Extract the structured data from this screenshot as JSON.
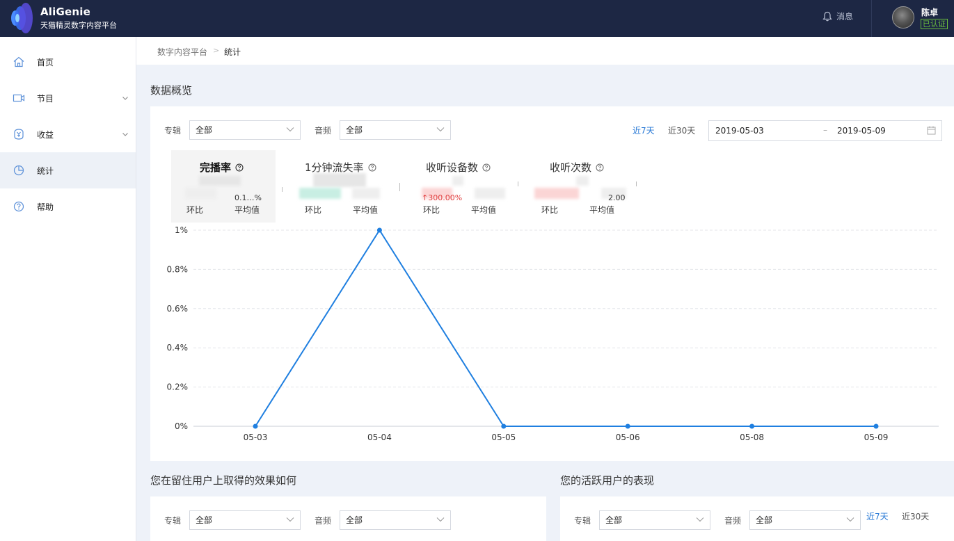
{
  "header": {
    "brand_name": "AliGenie",
    "brand_sub": "天猫精灵数字内容平台",
    "messages_label": "消息",
    "user_name": "陈卓",
    "verified_badge": "已认证"
  },
  "sidebar": {
    "items": [
      {
        "label": "首页",
        "icon": "home-icon",
        "has_arrow": false,
        "active": false
      },
      {
        "label": "节目",
        "icon": "video-icon",
        "has_arrow": true,
        "active": false
      },
      {
        "label": "收益",
        "icon": "yen-icon",
        "has_arrow": true,
        "active": false
      },
      {
        "label": "统计",
        "icon": "pie-chart-icon",
        "has_arrow": false,
        "active": true
      },
      {
        "label": "帮助",
        "icon": "help-icon",
        "has_arrow": false,
        "active": false
      }
    ]
  },
  "breadcrumb": {
    "root": "数字内容平台",
    "separator": ">",
    "current": "统计"
  },
  "overview": {
    "title": "数据概览",
    "filters": {
      "album_label": "专辑",
      "album_value": "全部",
      "audio_label": "音频",
      "audio_value": "全部"
    },
    "range": {
      "last7": "近7天",
      "last30": "近30天",
      "active": "last7"
    },
    "date_start": "2019-05-03",
    "date_sep": "–",
    "date_end": "2019-05-09",
    "metrics": [
      {
        "title": "完播率",
        "small_left": "",
        "small_right": "0.1…%",
        "foot_left": "环比",
        "foot_right": "平均值"
      },
      {
        "title": "1分钟流失率",
        "small_left": "",
        "small_right": "",
        "foot_left": "环比",
        "foot_right": "平均值"
      },
      {
        "title": "收听设备数",
        "small_left": "↑300.00%",
        "small_right": "",
        "foot_left": "环比",
        "foot_right": "平均值"
      },
      {
        "title": "收听次数",
        "small_left": "",
        "small_right": "2.00",
        "foot_left": "环比",
        "foot_right": "平均值"
      }
    ]
  },
  "chart_data": {
    "type": "line",
    "title": "",
    "xlabel": "",
    "ylabel": "",
    "categories": [
      "05-03",
      "05-04",
      "05-05",
      "05-06",
      "05-08",
      "05-09"
    ],
    "series": [
      {
        "values": [
          0,
          1,
          0,
          0,
          0,
          0
        ],
        "color": "#1f7fe0"
      }
    ],
    "ylim": [
      0,
      1
    ],
    "yticks": [
      0,
      0.2,
      0.4,
      0.6,
      0.8,
      1
    ],
    "ytick_labels": [
      "0%",
      "0.2%",
      "0.4%",
      "0.6%",
      "0.8%",
      "1%"
    ],
    "grid": true,
    "legend": "none"
  },
  "retention": {
    "title": "您在留住用户上取得的效果如何",
    "album_label": "专辑",
    "album_value": "全部",
    "audio_label": "音频",
    "audio_value": "全部"
  },
  "active_users": {
    "title": "您的活跃用户的表现",
    "album_label": "专辑",
    "album_value": "全部",
    "audio_label": "音频",
    "audio_value": "全部",
    "last7": "近7天",
    "last30": "近30天"
  },
  "colors": {
    "accent": "#2a7ad6",
    "header_bg": "#1d2744",
    "line": "#1f7fe0",
    "verified": "#6cbf3d",
    "down": "#e03a3a"
  }
}
